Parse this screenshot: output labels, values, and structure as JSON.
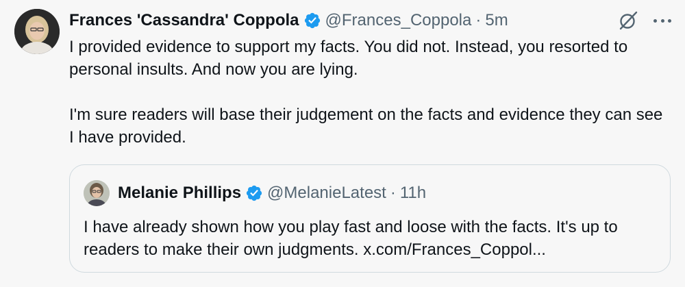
{
  "tweet": {
    "author_name": "Frances 'Cassandra' Coppola",
    "handle": "@Frances_Coppola",
    "separator": "·",
    "time": "5m",
    "paragraphs": [
      "I provided evidence to support my facts. You did not. Instead, you resorted to personal insults. And now you are lying.",
      "I'm sure readers will base their judgement on the facts and evidence they can see I have provided."
    ],
    "icons": {
      "verified": "verified-badge-icon",
      "grok": "grok-icon",
      "more": "more-icon"
    }
  },
  "quote": {
    "author_name": "Melanie Phillips",
    "handle": "@MelanieLatest",
    "separator": "·",
    "time": "11h",
    "text": "I have already shown how you play fast and loose with the facts. It's up to readers to make their own judgments. x.com/Frances_Coppol..."
  },
  "colors": {
    "verified": "#1d9bf0",
    "secondary_text": "#536471",
    "border": "#cfd9de"
  }
}
